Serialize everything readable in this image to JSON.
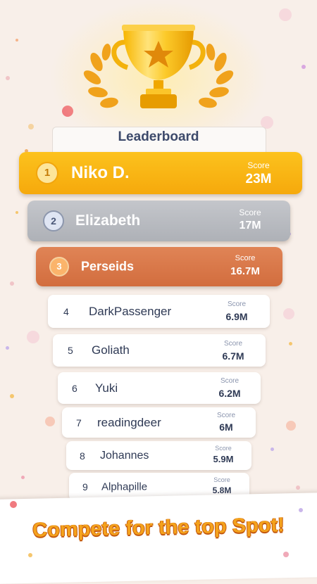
{
  "leaderboard": {
    "title": "Leaderboard",
    "score_label": "Score",
    "entries": [
      {
        "rank": "1",
        "name": "Niko D.",
        "score": "23M"
      },
      {
        "rank": "2",
        "name": "Elizabeth",
        "score": "17M"
      },
      {
        "rank": "3",
        "name": "Perseids",
        "score": "16.7M"
      },
      {
        "rank": "4",
        "name": "DarkPassenger",
        "score": "6.9M"
      },
      {
        "rank": "5",
        "name": "Goliath",
        "score": "6.7M"
      },
      {
        "rank": "6",
        "name": "Yuki",
        "score": "6.2M"
      },
      {
        "rank": "7",
        "name": "readingdeer",
        "score": "6M"
      },
      {
        "rank": "8",
        "name": "Johannes",
        "score": "5.9M"
      },
      {
        "rank": "9",
        "name": "Alphapille",
        "score": "5.8M"
      }
    ]
  },
  "banner": {
    "text": "Compete for the top Spot!"
  },
  "colors": {
    "gold": "#fbb813",
    "silver": "#b3b6bd",
    "bronze": "#d9794b",
    "title_text": "#3d4a6b",
    "banner_text": "#f4a21c"
  },
  "icons": {
    "trophy": "trophy-icon"
  }
}
